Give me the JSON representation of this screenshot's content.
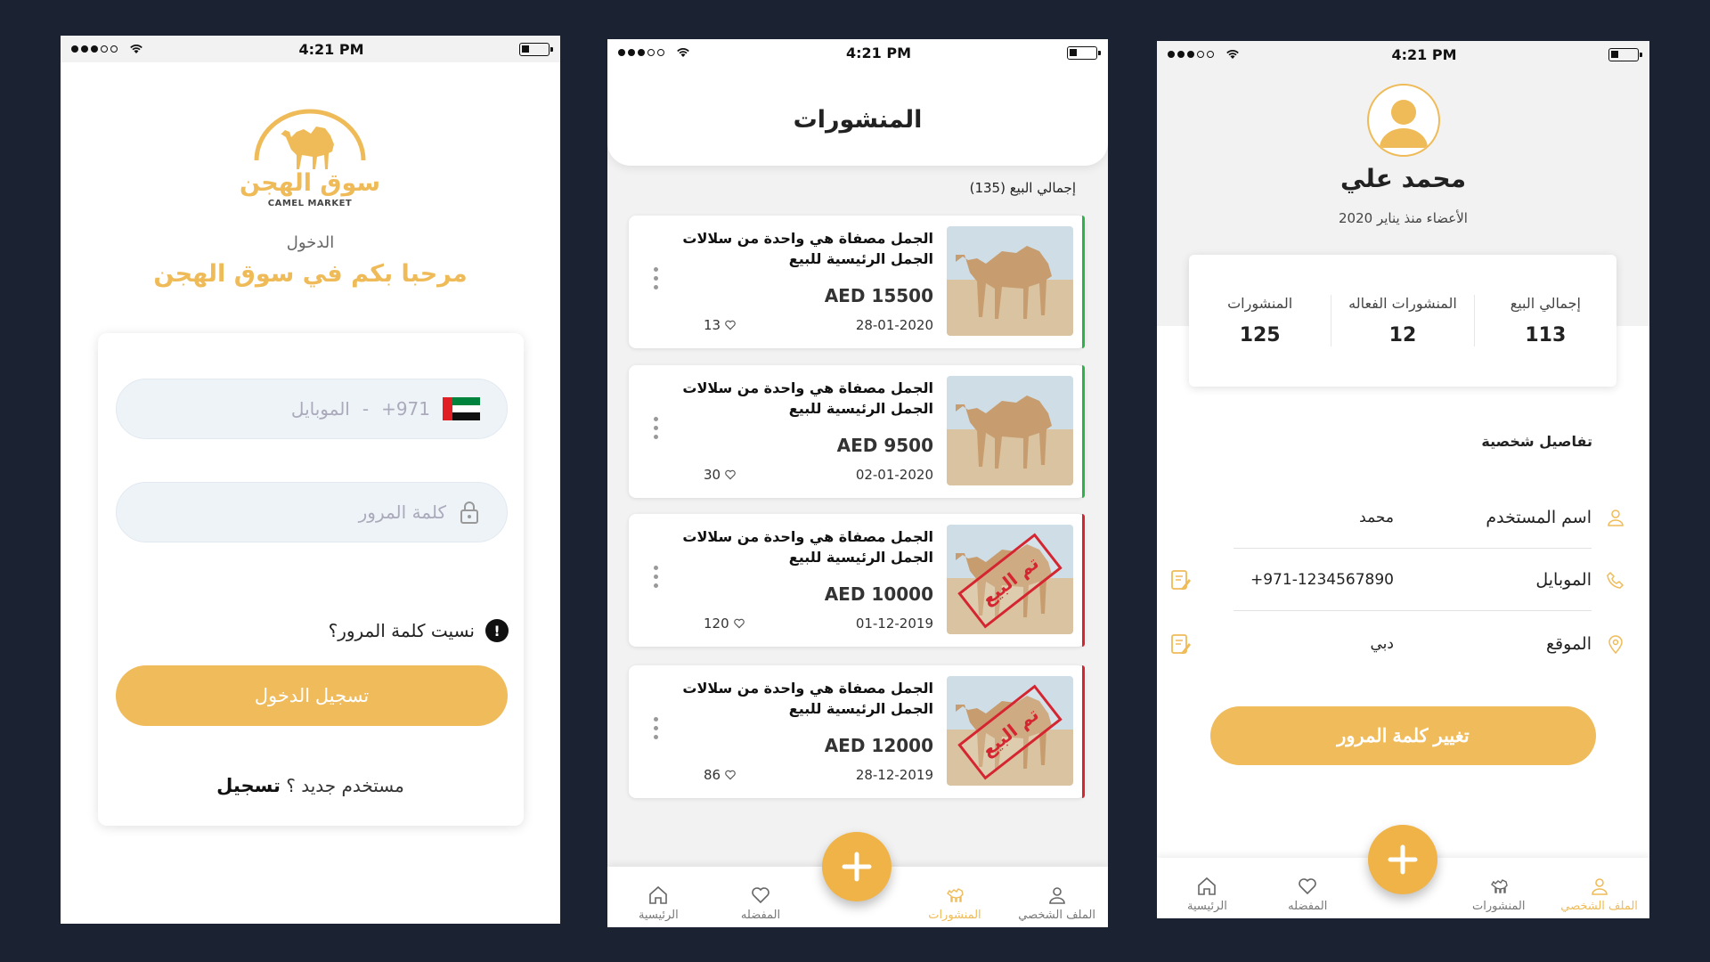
{
  "status": {
    "time": "4:21 PM"
  },
  "login": {
    "logo_ar": "سوق الهجن",
    "logo_en": "CAMEL MARKET",
    "login_label": "الدخول",
    "welcome": "مرحبا بكم في سوق الهجن",
    "country_code": "+971",
    "dash": "-",
    "mobile_placeholder": "الموبايل",
    "password_placeholder": "كلمة المرور",
    "forgot": "نسيت كلمة المرور؟",
    "forgot_icon": "!",
    "login_button": "تسجيل الدخول",
    "new_user": "مستخدم جديد ؟",
    "register": "تسجيل"
  },
  "posts": {
    "title": "المنشورات",
    "total": "إجمالي البيع (135)",
    "sold_stamp": "تم البيع",
    "items": [
      {
        "title": "الجمل مصفاة هي واحدة من سلالات الجمل الرئيسية للبيع",
        "price": "AED 15500",
        "date": "28-01-2020",
        "likes": "13",
        "status_color": "#2db34a"
      },
      {
        "title": "الجمل مصفاة هي واحدة من سلالات الجمل الرئيسية للبيع",
        "price": "AED 9500",
        "date": "02-01-2020",
        "likes": "30",
        "status_color": "#2db34a"
      },
      {
        "title": "الجمل مصفاة هي واحدة من سلالات الجمل الرئيسية للبيع",
        "price": "AED 10000",
        "date": "01-12-2019",
        "likes": "120",
        "status_color": "#d42530"
      },
      {
        "title": "الجمل مصفاة هي واحدة من سلالات الجمل الرئيسية للبيع",
        "price": "AED 12000",
        "date": "28-12-2019",
        "likes": "86",
        "status_color": "#d42530"
      }
    ]
  },
  "tabs": {
    "home": "الرئيسية",
    "favorites": "المفضله",
    "posts": "المنشورات",
    "profile": "الملف الشخصي"
  },
  "profile": {
    "name": "محمد علي",
    "member_since": "الأعضاء منذ يناير 2020",
    "stats": [
      {
        "label": "المنشورات",
        "value": "125"
      },
      {
        "label": "المنشورات الفعاله",
        "value": "12"
      },
      {
        "label": "إجمالي البيع",
        "value": "113"
      }
    ],
    "section_title": "تفاصيل شخصية",
    "username_label": "اسم المستخدم",
    "username_value": "محمد",
    "mobile_label": "الموبايل",
    "mobile_value": "+971-1234567890",
    "location_label": "الموقع",
    "location_value": "دبي",
    "change_password": "تغيير كلمة المرور"
  },
  "colors": {
    "accent": "#efbb58",
    "sold": "#d42530",
    "active": "#2db34a"
  }
}
